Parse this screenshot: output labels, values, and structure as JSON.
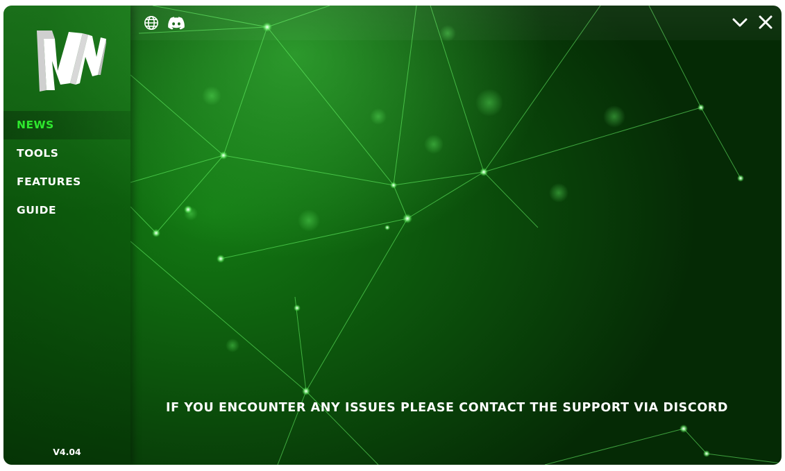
{
  "app": {
    "logo_icon": "nv-logo-icon",
    "version": "V4.04",
    "accent_color": "#2ee82e",
    "background_color": "#0b4e0b"
  },
  "topbar": {
    "icons": [
      "globe-icon",
      "discord-icon"
    ],
    "window_controls": [
      "chevron-down-icon",
      "close-icon"
    ]
  },
  "sidebar": {
    "items": [
      {
        "label": "NEWS",
        "active": true
      },
      {
        "label": "TOOLS",
        "active": false
      },
      {
        "label": "FEATURES",
        "active": false
      },
      {
        "label": "GUIDE",
        "active": false
      }
    ]
  },
  "main": {
    "notice": "IF YOU ENCOUNTER ANY ISSUES PLEASE CONTACT THE SUPPORT VIA DISCORD"
  }
}
